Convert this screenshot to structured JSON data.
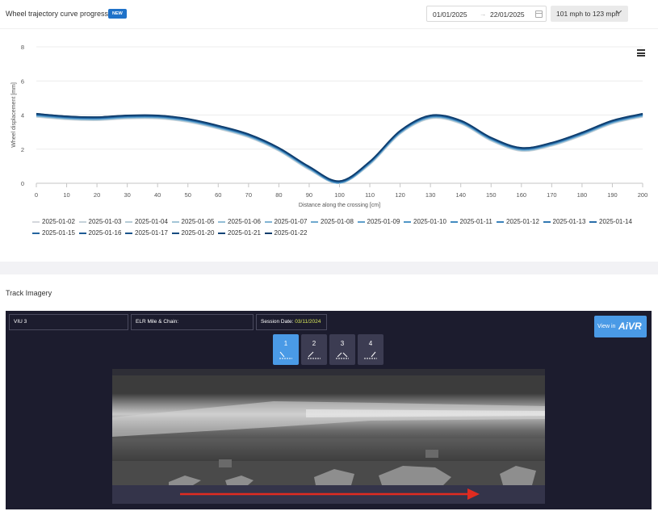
{
  "header": {
    "title": "Wheel trajectory curve progression",
    "badge": "NEW",
    "date_start": "01/01/2025",
    "date_arrow": "→",
    "date_end": "22/01/2025",
    "speed_range": "101 mph to 123 mph"
  },
  "chart_data": {
    "type": "line",
    "xlabel": "Distance along the crossing [cm]",
    "ylabel": "Wheel displacement [mm]",
    "xlim": [
      0,
      200
    ],
    "ylim": [
      0,
      8
    ],
    "x_ticks": [
      0,
      10,
      20,
      30,
      40,
      50,
      60,
      70,
      80,
      90,
      100,
      110,
      120,
      130,
      140,
      150,
      160,
      170,
      180,
      190,
      200
    ],
    "y_ticks": [
      0,
      2,
      4,
      6,
      8
    ],
    "x": [
      0,
      10,
      20,
      30,
      40,
      50,
      60,
      70,
      80,
      90,
      100,
      110,
      120,
      130,
      140,
      150,
      160,
      170,
      180,
      190,
      200
    ],
    "base_values": [
      4.0,
      3.85,
      3.8,
      3.9,
      3.9,
      3.7,
      3.3,
      2.8,
      2.0,
      0.9,
      0.05,
      1.2,
      3.0,
      3.9,
      3.6,
      2.6,
      2.0,
      2.3,
      2.9,
      3.6,
      4.0
    ],
    "legend_position": "bottom",
    "series": [
      {
        "name": "2025-01-02",
        "color": "#d4d7dc",
        "offset": -0.12
      },
      {
        "name": "2025-01-03",
        "color": "#c5d2da",
        "offset": -0.1
      },
      {
        "name": "2025-01-04",
        "color": "#b5cbd6",
        "offset": -0.09
      },
      {
        "name": "2025-01-05",
        "color": "#a3c5d7",
        "offset": -0.07
      },
      {
        "name": "2025-01-06",
        "color": "#92bdd6",
        "offset": -0.06
      },
      {
        "name": "2025-01-07",
        "color": "#81b4d3",
        "offset": -0.05
      },
      {
        "name": "2025-01-08",
        "color": "#6fa9cf",
        "offset": -0.03
      },
      {
        "name": "2025-01-09",
        "color": "#5f9fcb",
        "offset": -0.02
      },
      {
        "name": "2025-01-10",
        "color": "#5096c6",
        "offset": -0.01
      },
      {
        "name": "2025-01-11",
        "color": "#438bc0",
        "offset": 0.0
      },
      {
        "name": "2025-01-12",
        "color": "#3a82ba",
        "offset": 0.01
      },
      {
        "name": "2025-01-13",
        "color": "#3278b2",
        "offset": 0.02
      },
      {
        "name": "2025-01-14",
        "color": "#2a6ea9",
        "offset": 0.03
      },
      {
        "name": "2025-01-15",
        "color": "#24659f",
        "offset": 0.04
      },
      {
        "name": "2025-01-16",
        "color": "#1f5c95",
        "offset": 0.05
      },
      {
        "name": "2025-01-17",
        "color": "#1a548b",
        "offset": 0.06
      },
      {
        "name": "2025-01-20",
        "color": "#164c81",
        "offset": 0.07
      },
      {
        "name": "2025-01-21",
        "color": "#124477",
        "offset": 0.08
      },
      {
        "name": "2025-01-22",
        "color": "#0e3c6c",
        "offset": 0.09
      }
    ]
  },
  "section": {
    "title": "Track Imagery"
  },
  "imagery": {
    "viu": "VIU 3",
    "elr_label": "ELR Mile & Chain:",
    "session_label": "Session Date:",
    "session_value": "03/11/2024",
    "viewer_label": "View in",
    "viewer_logo": "AiVR",
    "tabs": [
      {
        "label": "1",
        "active": true,
        "glyph": "down-right"
      },
      {
        "label": "2",
        "active": false,
        "glyph": "up-left"
      },
      {
        "label": "3",
        "active": false,
        "glyph": "up-right-left"
      },
      {
        "label": "4",
        "active": false,
        "glyph": "up-right"
      }
    ],
    "arrow_color": "#e02b20"
  }
}
